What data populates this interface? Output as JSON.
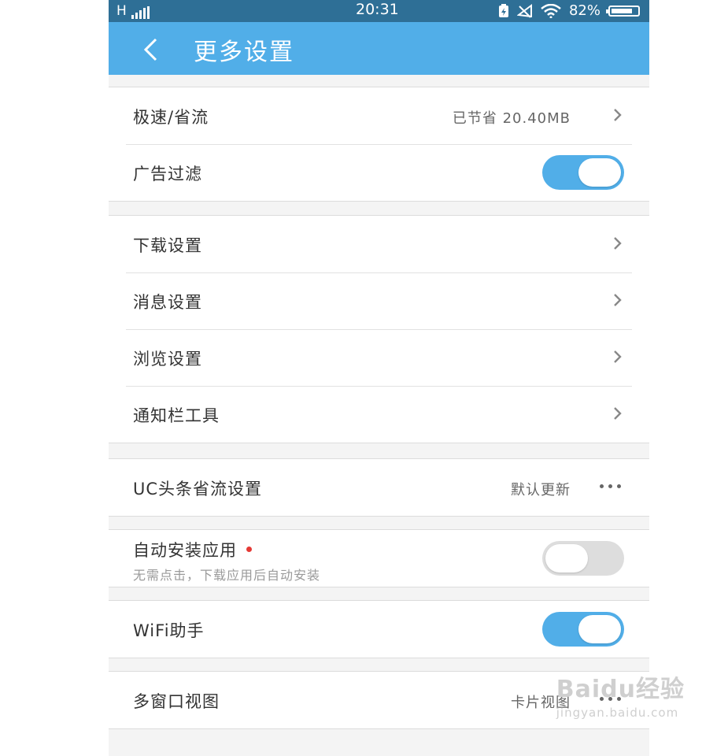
{
  "status_bar": {
    "network": "H",
    "time": "20:31",
    "battery_percent": "82%",
    "battery_level": 0.82,
    "icons": [
      "signal-icon",
      "battery-saver-icon",
      "mute-icon",
      "wifi-icon",
      "battery-icon"
    ]
  },
  "app_bar": {
    "title": "更多设置",
    "back_icon": "chevron-left-icon",
    "color": "#51aee8"
  },
  "sections": [
    {
      "rows": [
        {
          "label": "极速/省流",
          "value": "已节省 20.40MB",
          "control": "chevron"
        },
        {
          "label": "广告过滤",
          "control": "toggle",
          "on": true
        }
      ]
    },
    {
      "rows": [
        {
          "label": "下载设置",
          "control": "chevron"
        },
        {
          "label": "消息设置",
          "control": "chevron"
        },
        {
          "label": "浏览设置",
          "control": "chevron"
        },
        {
          "label": "通知栏工具",
          "control": "chevron"
        }
      ]
    },
    {
      "rows": [
        {
          "label": "UC头条省流设置",
          "value": "默认更新",
          "control": "more"
        }
      ]
    },
    {
      "rows": [
        {
          "label": "自动安装应用",
          "subtext": "无需点击，下载应用后自动安装",
          "control": "toggle",
          "on": false,
          "badge": "red-dot"
        }
      ]
    },
    {
      "rows": [
        {
          "label": "WiFi助手",
          "control": "toggle",
          "on": true
        }
      ]
    },
    {
      "rows": [
        {
          "label": "多窗口视图",
          "value": "卡片视图",
          "control": "more"
        }
      ]
    }
  ],
  "watermark": {
    "main": "Baidu经验",
    "url": "jingyan.baidu.com"
  },
  "colors": {
    "accent": "#51aee8",
    "status_bar": "#2e6f96",
    "badge": "#e53935"
  }
}
